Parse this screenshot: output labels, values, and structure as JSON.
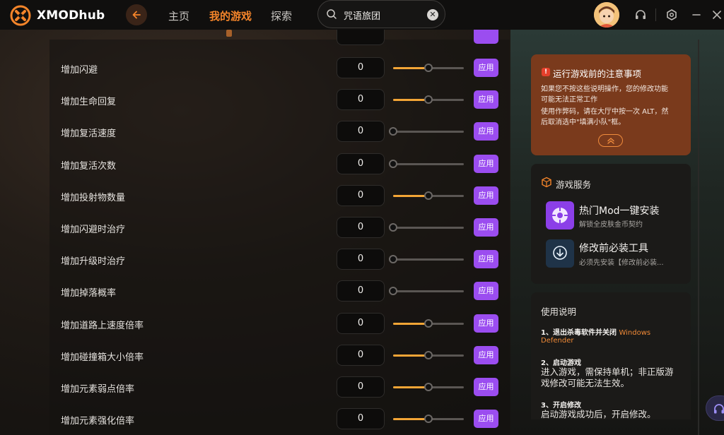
{
  "app": {
    "name_prefix": "XMOD",
    "name_suffix": "hub",
    "accent_color": "#f5852a",
    "apply_color": "#9b4df0",
    "slider_color": "#f3a536"
  },
  "nav": {
    "home": "主页",
    "my_games": "我的游戏",
    "explore": "探索",
    "active": "我的游戏"
  },
  "search": {
    "value": "咒语旅团"
  },
  "toolbar_icons": [
    "avatar",
    "headset-icon",
    "settings-icon",
    "minimize-icon",
    "close-icon"
  ],
  "mods": {
    "apply_label": "应用",
    "rows": [
      {
        "label": "增加闪避",
        "value": "0",
        "slider_level": 0.5
      },
      {
        "label": "增加生命回复",
        "value": "0",
        "slider_level": 0.5
      },
      {
        "label": "增加复活速度",
        "value": "0",
        "slider_level": 0
      },
      {
        "label": "增加复活次数",
        "value": "0",
        "slider_level": 0
      },
      {
        "label": "增加投射物数量",
        "value": "0",
        "slider_level": 0.5
      },
      {
        "label": "增加闪避时治疗",
        "value": "0",
        "slider_level": 0
      },
      {
        "label": "增加升级时治疗",
        "value": "0",
        "slider_level": 0
      },
      {
        "label": "增加掉落概率",
        "value": "0",
        "slider_level": 0
      },
      {
        "label": "增加道路上速度倍率",
        "value": "0",
        "slider_level": 0.5
      },
      {
        "label": "增加碰撞箱大小倍率",
        "value": "0",
        "slider_level": 0.5
      },
      {
        "label": "增加元素弱点倍率",
        "value": "0",
        "slider_level": 0.5
      },
      {
        "label": "增加元素强化倍率",
        "value": "0",
        "slider_level": 0.5
      }
    ]
  },
  "notice": {
    "title": "运行游戏前的注意事项",
    "line1": "如果您不按这些说明操作，您的修改功能",
    "line2": "可能无法正常工作",
    "line3": "使用作弊码，请在大厅中按一次 ALT，然",
    "line4": "后取消选中\"填满小队\"框。"
  },
  "service": {
    "title": "游戏服务",
    "items": [
      {
        "title": "热门Mod一键安装",
        "subtitle": "解锁全皮肤金币契约"
      },
      {
        "title": "修改前必装工具",
        "subtitle": "必须先安装【修改前必装..."
      }
    ]
  },
  "guide": {
    "title": "使用说明",
    "step1_title": "1、退出杀毒软件并关闭",
    "step1_highlight_a": "Windows",
    "step1_highlight_b": "Defender",
    "step2_title": "2、启动游戏",
    "step2_line1": "进入游戏，需保持单机；非正版游",
    "step2_line2": "戏修改可能无法生效。",
    "step3_title": "3、开启修改",
    "step3_line1": "启动游戏成功后，开启修改。"
  }
}
